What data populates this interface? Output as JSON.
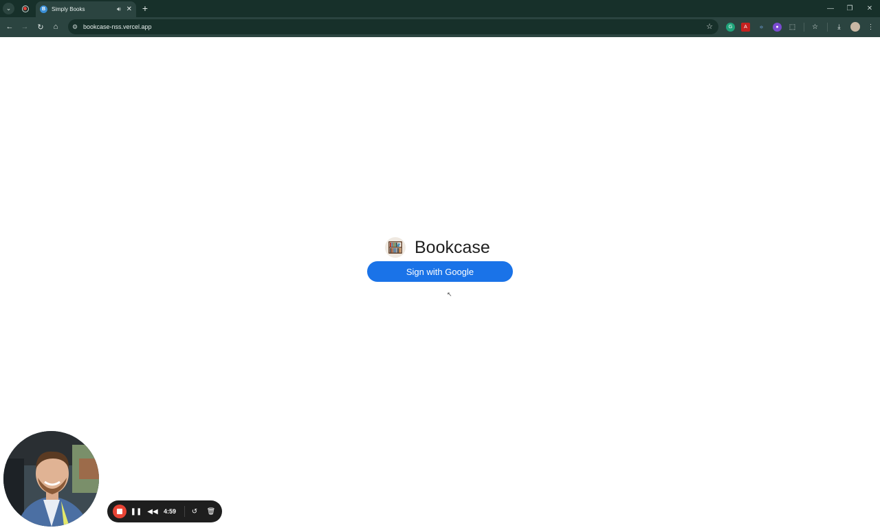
{
  "browser": {
    "tab_title": "Simply Books",
    "tab_favicon_letter": "B",
    "url": "bookcase-nss.vercel.app",
    "tab_icons": {
      "list": "chevron-down-icon",
      "audio": "speaker-icon",
      "close": "close-icon",
      "new": "plus-icon"
    },
    "nav_icons": [
      "back-arrow-icon",
      "forward-arrow-icon",
      "reload-icon",
      "home-icon"
    ],
    "extensions": [
      "grammarly-icon",
      "pdf-icon",
      "react-devtools-icon",
      "extension-purple-icon",
      "puzzle-icon"
    ],
    "colors": {
      "frame": "#17302a",
      "toolbar": "#2b4440"
    }
  },
  "page": {
    "brand_name": "Bookcase",
    "signin_label": "Sign with Google",
    "accent": "#1a73e8"
  },
  "recorder": {
    "time": "4:59",
    "icons": [
      "stop-icon",
      "pause-icon",
      "rewind-icon",
      "restart-icon",
      "trash-icon"
    ]
  }
}
